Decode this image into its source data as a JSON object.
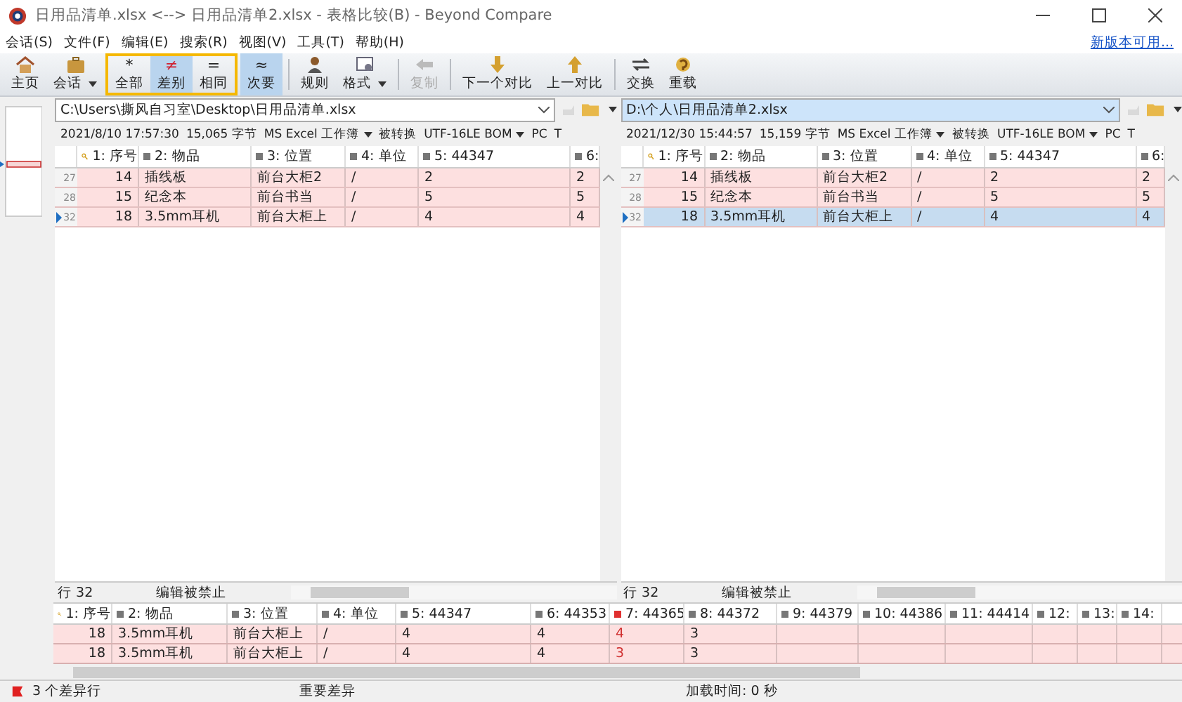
{
  "window": {
    "title": "日用品清单.xlsx <--> 日用品清单2.xlsx - 表格比较(B) - Beyond Compare"
  },
  "menu": [
    "会话(S)",
    "文件(F)",
    "编辑(E)",
    "搜索(R)",
    "视图(V)",
    "工具(T)",
    "帮助(H)"
  ],
  "update_link": "新版本可用...",
  "toolbar": {
    "start": [
      {
        "label": "主页",
        "has_menu": false
      },
      {
        "label": "会话",
        "has_menu": true
      }
    ],
    "filters": [
      {
        "symbol": "*",
        "label": "全部",
        "selected": false
      },
      {
        "symbol": "≠",
        "label": "差别",
        "selected": true
      },
      {
        "symbol": "=",
        "label": "相同",
        "selected": false
      }
    ],
    "minor": {
      "symbol": "≈",
      "label": "次要",
      "on": true
    },
    "rest": [
      {
        "label": "规则",
        "has_menu": false,
        "disabled": false
      },
      {
        "label": "格式",
        "has_menu": true,
        "disabled": false
      },
      {
        "label": "复制",
        "has_menu": false,
        "disabled": true
      },
      {
        "label": "下一个对比",
        "has_menu": false,
        "disabled": false
      },
      {
        "label": "上一对比",
        "has_menu": false,
        "disabled": false
      },
      {
        "label": "交换",
        "has_menu": false,
        "disabled": false
      },
      {
        "label": "重载",
        "has_menu": false,
        "disabled": false
      }
    ]
  },
  "panes": [
    {
      "path": "C:\\Users\\撕风自习室\\Desktop\\日用品清单.xlsx",
      "focused": false,
      "info": {
        "date": "2021/8/10 17:57:30",
        "size": "15,065 字节",
        "format": "MS Excel 工作簿",
        "converted": "被转换",
        "encoding": "UTF-16LE BOM",
        "line_end": "PC",
        "extra": "T"
      },
      "columns": [
        "1: 序号",
        "2: 物品",
        "3: 位置",
        "4: 单位",
        "5: 44347",
        "6:"
      ],
      "rows": [
        {
          "line": "27",
          "current": false,
          "selected": false,
          "cells": [
            "14",
            "插线板",
            "前台大柜2",
            "/",
            "2",
            "2"
          ]
        },
        {
          "line": "28",
          "current": false,
          "selected": false,
          "cells": [
            "15",
            "纪念本",
            "前台书当",
            "/",
            "5",
            "5"
          ]
        },
        {
          "line": "32",
          "current": true,
          "selected": false,
          "cells": [
            "18",
            "3.5mm耳机",
            "前台大柜上",
            "/",
            "4",
            "4"
          ]
        }
      ],
      "status": {
        "position": "行 32",
        "mode": "编辑被禁止"
      }
    },
    {
      "path": "D:\\个人\\日用品清单2.xlsx",
      "focused": true,
      "info": {
        "date": "2021/12/30 15:44:57",
        "size": "15,159 字节",
        "format": "MS Excel 工作簿",
        "converted": "被转换",
        "encoding": "UTF-16LE BOM",
        "line_end": "PC",
        "extra": "T"
      },
      "columns": [
        "1: 序号",
        "2: 物品",
        "3: 位置",
        "4: 单位",
        "5: 44347",
        "6:"
      ],
      "rows": [
        {
          "line": "27",
          "current": false,
          "selected": false,
          "cells": [
            "14",
            "插线板",
            "前台大柜2",
            "/",
            "2",
            "2"
          ]
        },
        {
          "line": "28",
          "current": false,
          "selected": false,
          "cells": [
            "15",
            "纪念本",
            "前台书当",
            "/",
            "5",
            "5"
          ]
        },
        {
          "line": "32",
          "current": true,
          "selected": true,
          "cells": [
            "18",
            "3.5mm耳机",
            "前台大柜上",
            "/",
            "4",
            "4"
          ]
        }
      ],
      "status": {
        "position": "行 32",
        "mode": "编辑被禁止"
      }
    }
  ],
  "detail": {
    "columns": [
      {
        "label": "1: 序号",
        "changed": false
      },
      {
        "label": "2: 物品",
        "changed": false
      },
      {
        "label": "3: 位置",
        "changed": false
      },
      {
        "label": "4: 单位",
        "changed": false
      },
      {
        "label": "5: 44347",
        "changed": false
      },
      {
        "label": "6: 44353",
        "changed": false
      },
      {
        "label": "7: 44365",
        "changed": true
      },
      {
        "label": "8: 44372",
        "changed": false
      },
      {
        "label": "9: 44379",
        "changed": false
      },
      {
        "label": "10: 44386",
        "changed": false
      },
      {
        "label": "11: 44414",
        "changed": false
      },
      {
        "label": "12:",
        "changed": false
      },
      {
        "label": "13:",
        "changed": false
      },
      {
        "label": "14:",
        "changed": false
      }
    ],
    "rows": [
      [
        "18",
        "3.5mm耳机",
        "前台大柜上",
        "/",
        "4",
        "4",
        "4",
        "3"
      ],
      [
        "18",
        "3.5mm耳机",
        "前台大柜上",
        "/",
        "4",
        "4",
        "3",
        "3"
      ]
    ]
  },
  "status_bar": {
    "differences": "3 个差异行",
    "filter": "重要差异",
    "load_time": "加载时间:  0 秒"
  }
}
